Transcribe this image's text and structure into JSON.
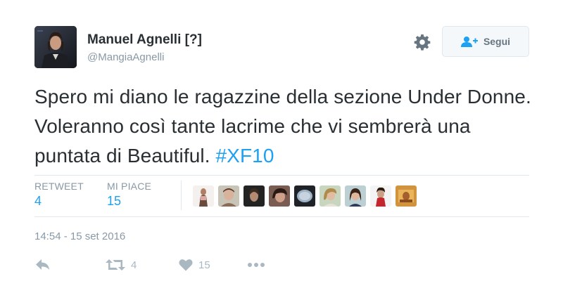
{
  "author": {
    "name": "Manuel Agnelli [?]",
    "handle": "@MangiaAgnelli"
  },
  "header": {
    "follow_label": "Segui",
    "settings_icon": "gear-icon",
    "follow_icon": "follow-user-icon"
  },
  "tweet": {
    "text": "Spero mi diano le ragazzine della sezione Under Donne. Voleranno così tante lacrime che vi sembrerà una puntata di Beautiful. ",
    "hashtag": "#XF10",
    "timestamp": "14:54 - 15 set 2016"
  },
  "stats": {
    "retweet_label": "RETWEET",
    "retweet_count": "4",
    "like_label": "MI PIACE",
    "like_count": "15"
  },
  "likers_count_shown": 9,
  "actions": {
    "reply_icon": "reply-icon",
    "retweet_icon": "retweet-icon",
    "retweet_count": "4",
    "like_icon": "heart-icon",
    "like_count": "15",
    "more_icon": "more-icon"
  },
  "colors": {
    "link": "#1da1f2",
    "muted": "#8899a6",
    "text": "#292f33",
    "border": "#e1e8ed"
  }
}
